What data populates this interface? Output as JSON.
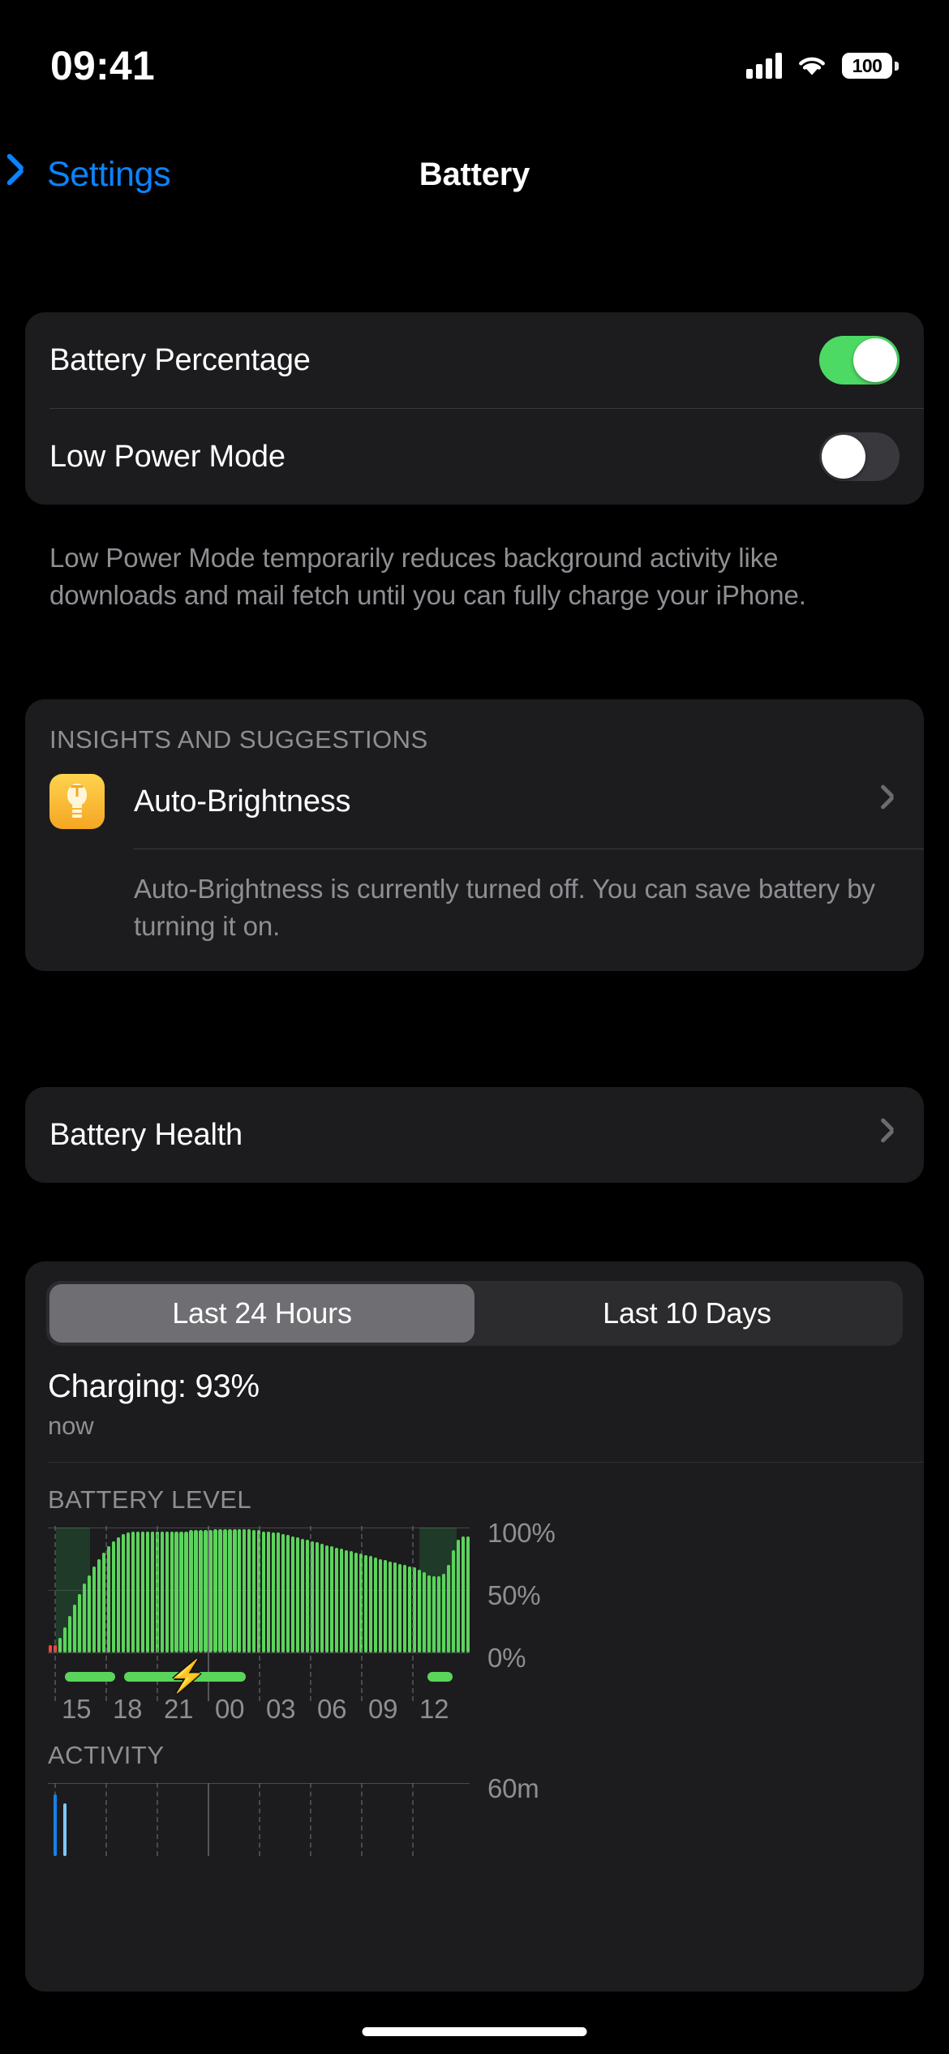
{
  "status_bar": {
    "time": "09:41",
    "signal_icon": "cellular-signal-icon",
    "wifi_icon": "wifi-icon",
    "battery_level": "100",
    "battery_icon": "battery-full-icon"
  },
  "nav": {
    "back_label": "Settings",
    "back_icon": "chevron-left-icon",
    "title": "Battery"
  },
  "toggles": {
    "battery_percentage": {
      "label": "Battery Percentage",
      "state": "on"
    },
    "low_power_mode": {
      "label": "Low Power Mode",
      "state": "off"
    },
    "footer": "Low Power Mode temporarily reduces background activity like downloads and mail fetch until you can fully charge your iPhone."
  },
  "insights": {
    "header": "INSIGHTS AND SUGGESTIONS",
    "item_label": "Auto-Brightness",
    "item_icon": "lightbulb-icon",
    "disclosure_icon": "chevron-right-icon",
    "description": "Auto-Brightness is currently turned off. You can save battery by turning it on."
  },
  "battery_health": {
    "label": "Battery Health",
    "disclosure_icon": "chevron-right-icon"
  },
  "usage": {
    "segments": [
      "Last 24 Hours",
      "Last 10 Days"
    ],
    "selected_segment": "Last 24 Hours",
    "charge_status": "Charging: 93%",
    "charge_time": "now",
    "battery_level_header": "BATTERY LEVEL",
    "activity_header": "ACTIVITY",
    "activity_y_max": "60m",
    "charging_icon": "lightning-bolt-icon"
  },
  "colors": {
    "accent_blue": "#0A84FF",
    "toggle_on_green": "#4CD964",
    "bar_green": "#5BD45B",
    "bar_red": "#FF453A",
    "activity_blue_dark": "#0A84FF",
    "activity_blue_light": "#7EC8F8",
    "card_bg": "#1C1C1E",
    "secondary_text": "#8E8E93"
  },
  "chart_data": {
    "type": "bar",
    "title": "BATTERY LEVEL",
    "xlabel": "",
    "ylabel": "Battery Level",
    "ylim": [
      0,
      100
    ],
    "ytick_labels": [
      "100%",
      "50%",
      "0%"
    ],
    "yticks": [
      100,
      50,
      0
    ],
    "xtick_labels": [
      "15",
      "18",
      "21",
      "00",
      "03",
      "06",
      "09",
      "12"
    ],
    "grid": "dashed-vertical",
    "legend": "none",
    "series": [
      {
        "name": "Battery Level",
        "values": [
          6,
          6,
          12,
          20,
          29,
          38,
          47,
          55,
          62,
          69,
          75,
          80,
          85,
          89,
          92,
          95,
          96,
          97,
          97,
          97,
          97,
          97,
          97,
          97,
          97,
          97,
          97,
          97,
          97,
          98,
          98,
          98,
          98,
          98,
          99,
          99,
          99,
          99,
          99,
          99,
          99,
          99,
          98,
          98,
          97,
          97,
          96,
          96,
          95,
          94,
          93,
          92,
          91,
          90,
          89,
          88,
          87,
          86,
          85,
          84,
          83,
          82,
          81,
          80,
          79,
          78,
          77,
          76,
          75,
          74,
          73,
          72,
          71,
          70,
          69,
          68,
          66,
          64,
          62,
          61,
          61,
          63,
          70,
          82,
          90,
          93,
          93
        ],
        "colors": [
          "red",
          "red",
          "green",
          "green",
          "green",
          "green",
          "green",
          "green",
          "green",
          "green",
          "green",
          "green",
          "green",
          "green",
          "green",
          "green",
          "green",
          "green",
          "green",
          "green",
          "green",
          "green",
          "green",
          "green",
          "green",
          "green",
          "green",
          "green",
          "green",
          "green",
          "green",
          "green",
          "green",
          "green",
          "green",
          "green",
          "green",
          "green",
          "green",
          "green",
          "green",
          "green",
          "green",
          "green",
          "green",
          "green",
          "green",
          "green",
          "green",
          "green",
          "green",
          "green",
          "green",
          "green",
          "green",
          "green",
          "green",
          "green",
          "green",
          "green",
          "green",
          "green",
          "green",
          "green",
          "green",
          "green",
          "green",
          "green",
          "green",
          "green",
          "green",
          "green",
          "green",
          "green",
          "green",
          "green",
          "green",
          "green",
          "green",
          "green",
          "green",
          "green",
          "green",
          "green",
          "green",
          "green",
          "green"
        ]
      }
    ],
    "shaded_regions": [
      {
        "label": "low-power-or-charging-shade",
        "start_pct": 2,
        "end_pct": 10
      },
      {
        "label": "low-power-or-charging-shade",
        "start_pct": 88,
        "end_pct": 97
      }
    ],
    "charging_periods": [
      {
        "start_pct": 4,
        "end_pct": 16
      },
      {
        "start_pct": 18,
        "end_pct": 47
      },
      {
        "start_pct": 90,
        "end_pct": 96
      }
    ],
    "activity": {
      "type": "bar",
      "title": "ACTIVITY",
      "ylim": [
        0,
        60
      ],
      "ytick_labels": [
        "60m"
      ],
      "values": [
        0,
        52,
        0,
        44,
        0,
        0,
        0,
        0,
        0,
        0,
        0,
        0,
        0,
        0,
        0,
        0,
        0,
        0,
        0,
        0,
        0,
        0,
        0,
        0,
        0,
        0,
        0,
        0,
        0,
        0,
        0,
        0,
        0,
        0,
        0,
        0,
        0,
        0,
        0,
        0,
        0,
        0,
        0,
        0,
        0,
        0,
        0,
        0,
        0,
        0,
        0,
        0,
        0,
        0,
        0,
        0,
        0,
        0,
        0,
        0,
        0,
        0,
        0,
        0,
        0,
        0,
        0,
        0,
        0,
        0,
        0,
        0,
        0,
        0,
        0,
        0,
        0,
        0,
        0,
        0,
        0,
        0,
        0,
        0,
        0,
        0,
        0
      ],
      "colors": [
        "",
        "dark",
        "",
        "light",
        "",
        "",
        "",
        "",
        "",
        "",
        "",
        "",
        "",
        "",
        "",
        "",
        "",
        "",
        "",
        "",
        "",
        "",
        "",
        "",
        "",
        "",
        "",
        "",
        "",
        "",
        "",
        "",
        "",
        "",
        "",
        "",
        "",
        "",
        "",
        "",
        "",
        "",
        "",
        "",
        "",
        "",
        "",
        "",
        "",
        "",
        "",
        "",
        "",
        "",
        "",
        "",
        "",
        "",
        "",
        "",
        "",
        "",
        "",
        "",
        "",
        "",
        "",
        "",
        "",
        "",
        "",
        "",
        "",
        "",
        "",
        "",
        "",
        "",
        "",
        "",
        "",
        "",
        "",
        "",
        "",
        "",
        ""
      ]
    }
  }
}
